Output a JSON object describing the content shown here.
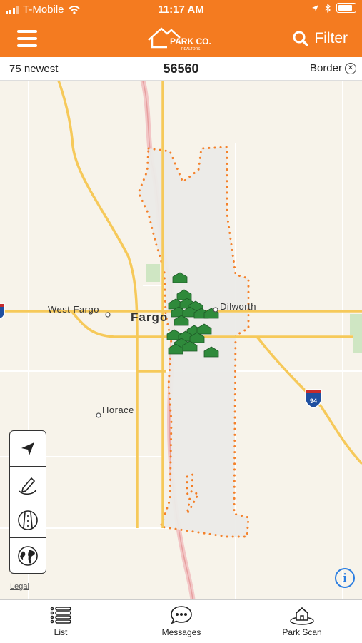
{
  "status_bar": {
    "carrier": "T-Mobile",
    "time": "11:17 AM"
  },
  "header": {
    "logo_main": "PARK CO.",
    "logo_sub": "REALTORS",
    "filter_label": "Filter"
  },
  "subbar": {
    "left": "75 newest",
    "center": "56560",
    "right": "Border"
  },
  "map": {
    "labels": {
      "west_fargo": "West Fargo",
      "fargo": "Fargo",
      "dilworth": "Dilworth",
      "horace": "Horace",
      "interstate": "94"
    },
    "legal": "Legal",
    "info": "i"
  },
  "tabs": [
    {
      "label": "List",
      "icon": "list-icon"
    },
    {
      "label": "Messages",
      "icon": "messages-icon"
    },
    {
      "label": "Park Scan",
      "icon": "park-scan-icon"
    }
  ],
  "colors": {
    "brand": "#f47b20",
    "pin": "#2f8a3b",
    "info": "#2a7de1"
  }
}
